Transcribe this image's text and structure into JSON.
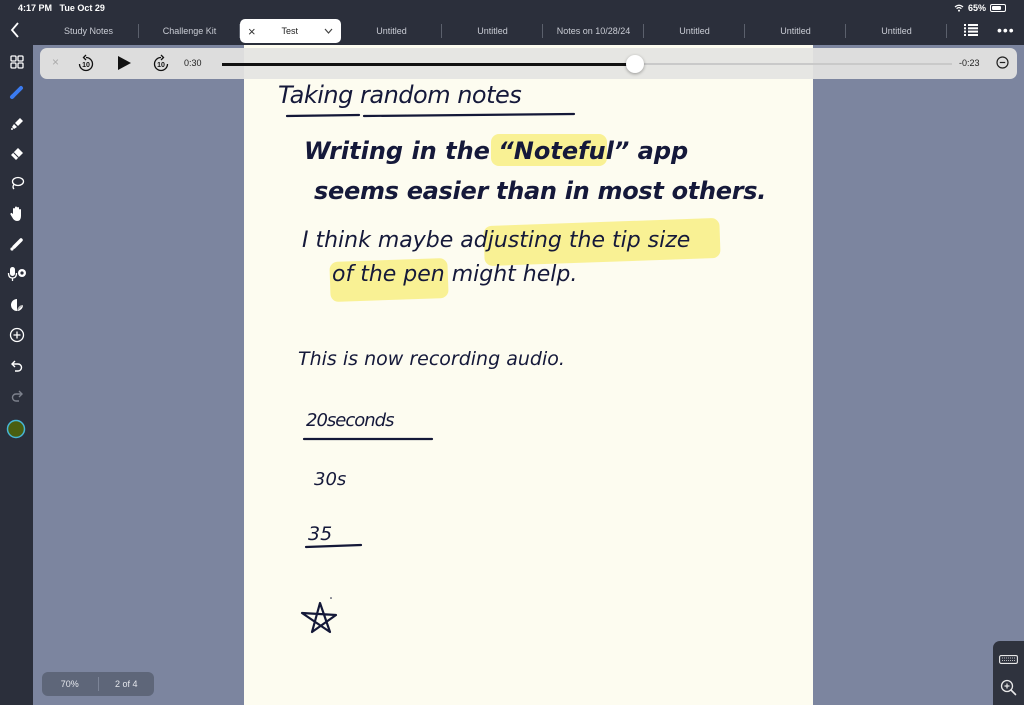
{
  "status_bar": {
    "time": "4:17 PM",
    "date": "Tue Oct 29",
    "battery": "65%"
  },
  "tabs": [
    {
      "label": "Study Notes",
      "active": false
    },
    {
      "label": "Challenge Kit",
      "active": false
    },
    {
      "label": "Test",
      "active": true
    },
    {
      "label": "Untitled",
      "active": false
    },
    {
      "label": "Untitled",
      "active": false
    },
    {
      "label": "Notes on 10/28/24",
      "active": false
    },
    {
      "label": "Untitled",
      "active": false
    },
    {
      "label": "Untitled",
      "active": false
    },
    {
      "label": "Untitled",
      "active": false
    }
  ],
  "tab_controls": {
    "close": "×",
    "dropdown": "⌄",
    "more": "•••",
    "back": "‹"
  },
  "audio_player": {
    "skip_back_seconds": "10",
    "skip_forward_seconds": "10",
    "elapsed": "0:30",
    "remaining": "-0:23",
    "progress_fraction": 0.566
  },
  "sidebar_tools": [
    {
      "name": "pen-tool",
      "active": true
    },
    {
      "name": "highlighter-tool"
    },
    {
      "name": "eraser-tool"
    },
    {
      "name": "lasso-tool"
    },
    {
      "name": "hand-tool"
    },
    {
      "name": "laser-pointer-tool"
    },
    {
      "name": "audio-record-tool"
    },
    {
      "name": "sticker-tool"
    },
    {
      "name": "add-tool"
    },
    {
      "name": "undo"
    },
    {
      "name": "redo"
    },
    {
      "name": "color-swatch",
      "color": "#4a5e10"
    }
  ],
  "note": {
    "title": "Taking random notes",
    "lines": [
      "Writing in the “Noteful” app",
      "seems easier than in most others.",
      "I think maybe adjusting the tip size",
      "of the pen might help.",
      "This is now recording audio.",
      "20seconds",
      "30s",
      "35"
    ],
    "highlight_color": "#f8ef8a",
    "ink_color": "#141838"
  },
  "footer": {
    "zoom": "70%",
    "page": "2 of 4"
  },
  "colors": {
    "toolbar_bg": "#2b2f3b",
    "canvas_bg": "#7c859f",
    "paper": "#fdfcf0",
    "accent": "#3b7bf0"
  }
}
